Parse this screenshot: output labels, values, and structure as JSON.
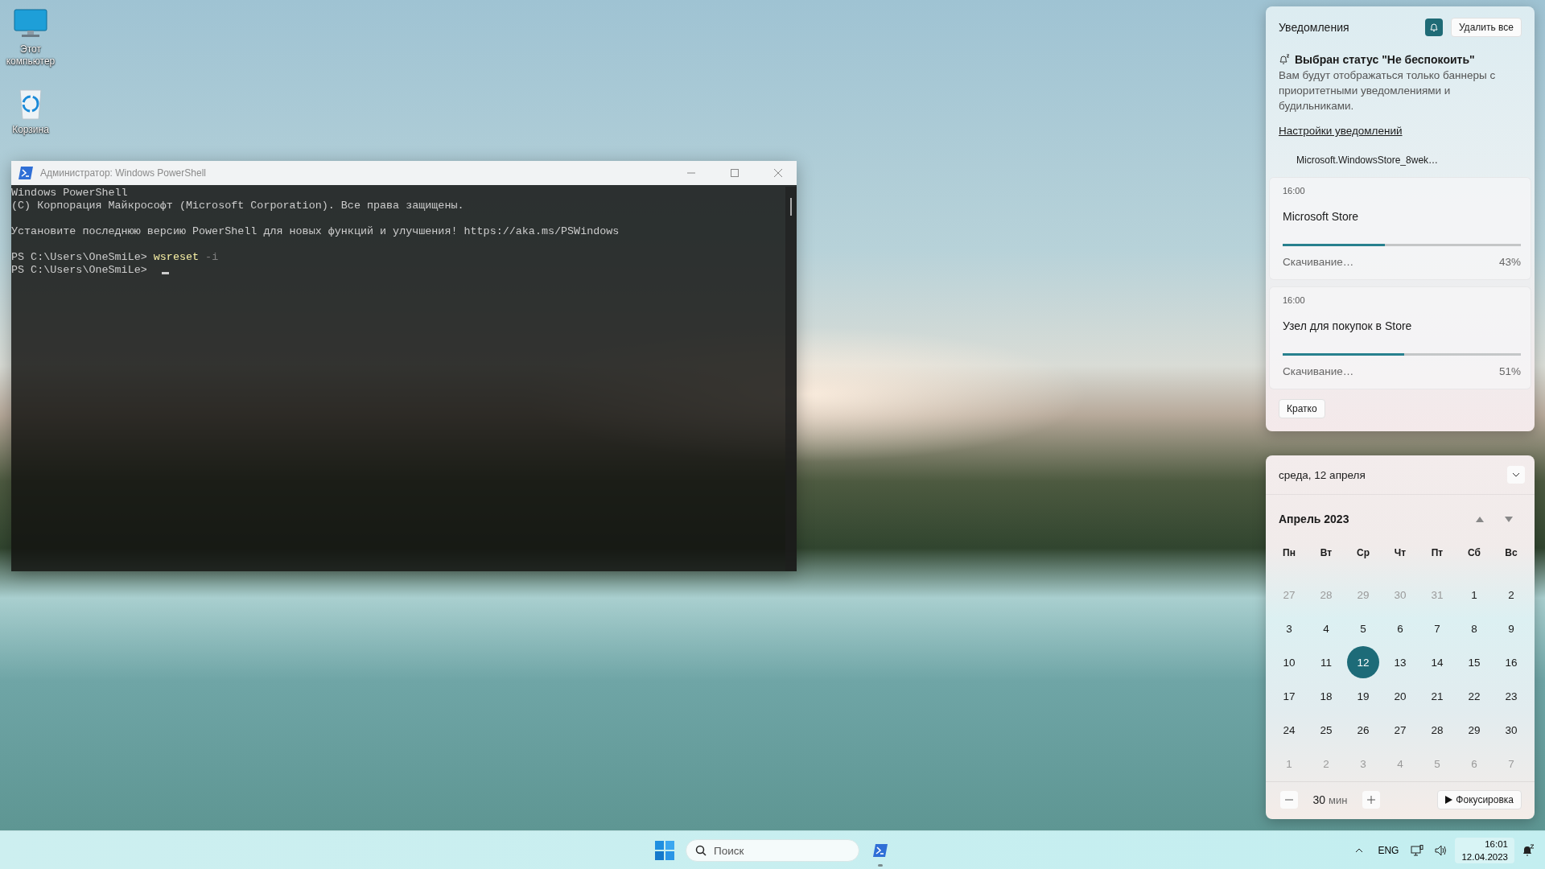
{
  "desktop_icons": [
    {
      "label": "Этот компьютер",
      "kind": "computer"
    },
    {
      "label": "Корзина",
      "kind": "recycle"
    }
  ],
  "powershell": {
    "title": "Администратор: Windows PowerShell",
    "blocks": [
      [
        {
          "text": "Windows PowerShell"
        },
        {
          "text": "(C) Корпорация Майкрософт (Microsoft Corporation). Все права защищены."
        }
      ],
      [
        {
          "text": "Установите последнюю версию PowerShell для новых функций и улучшения! https://aka.ms/PSWindows"
        }
      ],
      [
        {
          "prompt": "PS C:\\Users\\OneSmiLe>",
          "command": "wsreset",
          "argument": "-i"
        },
        {
          "prompt": "PS C:\\Users\\OneSmiLe>",
          "cursor": true
        }
      ]
    ]
  },
  "notifications": {
    "title": "Уведомления",
    "dnd_on": true,
    "clear_all": "Удалить все",
    "dnd_heading": "Выбран статус \"Не беспокоить\"",
    "dnd_text": "Вам будут отображаться только баннеры с приоритетными уведомлениями и будильниками.",
    "settings_link": "Настройки уведомлений",
    "app_group": "Microsoft.WindowsStore_8wek…",
    "items": [
      {
        "time": "16:00",
        "title": "Microsoft Store",
        "status": "Скачивание…",
        "percent": "43%",
        "level": 0.43
      },
      {
        "time": "16:00",
        "title": "Узел для покупок в Store",
        "status": "Скачивание…",
        "percent": "51%",
        "level": 0.51
      }
    ],
    "collapse": "Кратко"
  },
  "calendar": {
    "date_header": "среда, 12 апреля",
    "month": "Апрель 2023",
    "weekdays": [
      "Пн",
      "Вт",
      "Ср",
      "Чт",
      "Пт",
      "Сб",
      "Вс"
    ],
    "weeks": [
      [
        {
          "day": "27",
          "outside": true,
          "selected": false
        },
        {
          "day": "28",
          "outside": true,
          "selected": false
        },
        {
          "day": "29",
          "outside": true,
          "selected": false
        },
        {
          "day": "30",
          "outside": true,
          "selected": false
        },
        {
          "day": "31",
          "outside": true,
          "selected": false
        },
        {
          "day": "1",
          "outside": false,
          "selected": false
        },
        {
          "day": "2",
          "outside": false,
          "selected": false
        }
      ],
      [
        {
          "day": "3",
          "outside": false,
          "selected": false
        },
        {
          "day": "4",
          "outside": false,
          "selected": false
        },
        {
          "day": "5",
          "outside": false,
          "selected": false
        },
        {
          "day": "6",
          "outside": false,
          "selected": false
        },
        {
          "day": "7",
          "outside": false,
          "selected": false
        },
        {
          "day": "8",
          "outside": false,
          "selected": false
        },
        {
          "day": "9",
          "outside": false,
          "selected": false
        }
      ],
      [
        {
          "day": "10",
          "outside": false,
          "selected": false
        },
        {
          "day": "11",
          "outside": false,
          "selected": false
        },
        {
          "day": "12",
          "outside": false,
          "selected": true
        },
        {
          "day": "13",
          "outside": false,
          "selected": false
        },
        {
          "day": "14",
          "outside": false,
          "selected": false
        },
        {
          "day": "15",
          "outside": false,
          "selected": false
        },
        {
          "day": "16",
          "outside": false,
          "selected": false
        }
      ],
      [
        {
          "day": "17",
          "outside": false,
          "selected": false
        },
        {
          "day": "18",
          "outside": false,
          "selected": false
        },
        {
          "day": "19",
          "outside": false,
          "selected": false
        },
        {
          "day": "20",
          "outside": false,
          "selected": false
        },
        {
          "day": "21",
          "outside": false,
          "selected": false
        },
        {
          "day": "22",
          "outside": false,
          "selected": false
        },
        {
          "day": "23",
          "outside": false,
          "selected": false
        }
      ],
      [
        {
          "day": "24",
          "outside": false,
          "selected": false
        },
        {
          "day": "25",
          "outside": false,
          "selected": false
        },
        {
          "day": "26",
          "outside": false,
          "selected": false
        },
        {
          "day": "27",
          "outside": false,
          "selected": false
        },
        {
          "day": "28",
          "outside": false,
          "selected": false
        },
        {
          "day": "29",
          "outside": false,
          "selected": false
        },
        {
          "day": "30",
          "outside": false,
          "selected": false
        }
      ],
      [
        {
          "day": "1",
          "outside": true,
          "selected": false
        },
        {
          "day": "2",
          "outside": true,
          "selected": false
        },
        {
          "day": "3",
          "outside": true,
          "selected": false
        },
        {
          "day": "4",
          "outside": true,
          "selected": false
        },
        {
          "day": "5",
          "outside": true,
          "selected": false
        },
        {
          "day": "6",
          "outside": true,
          "selected": false
        },
        {
          "day": "7",
          "outside": true,
          "selected": false
        }
      ]
    ],
    "focus": {
      "minutes": "30",
      "unit": "мин",
      "start": "Фокусировка"
    }
  },
  "taskbar": {
    "search_placeholder": "Поиск",
    "apps": [
      {
        "kind": "powershell",
        "running": true
      }
    ],
    "language": "ENG",
    "time": "16:01",
    "date": "12.04.2023"
  }
}
